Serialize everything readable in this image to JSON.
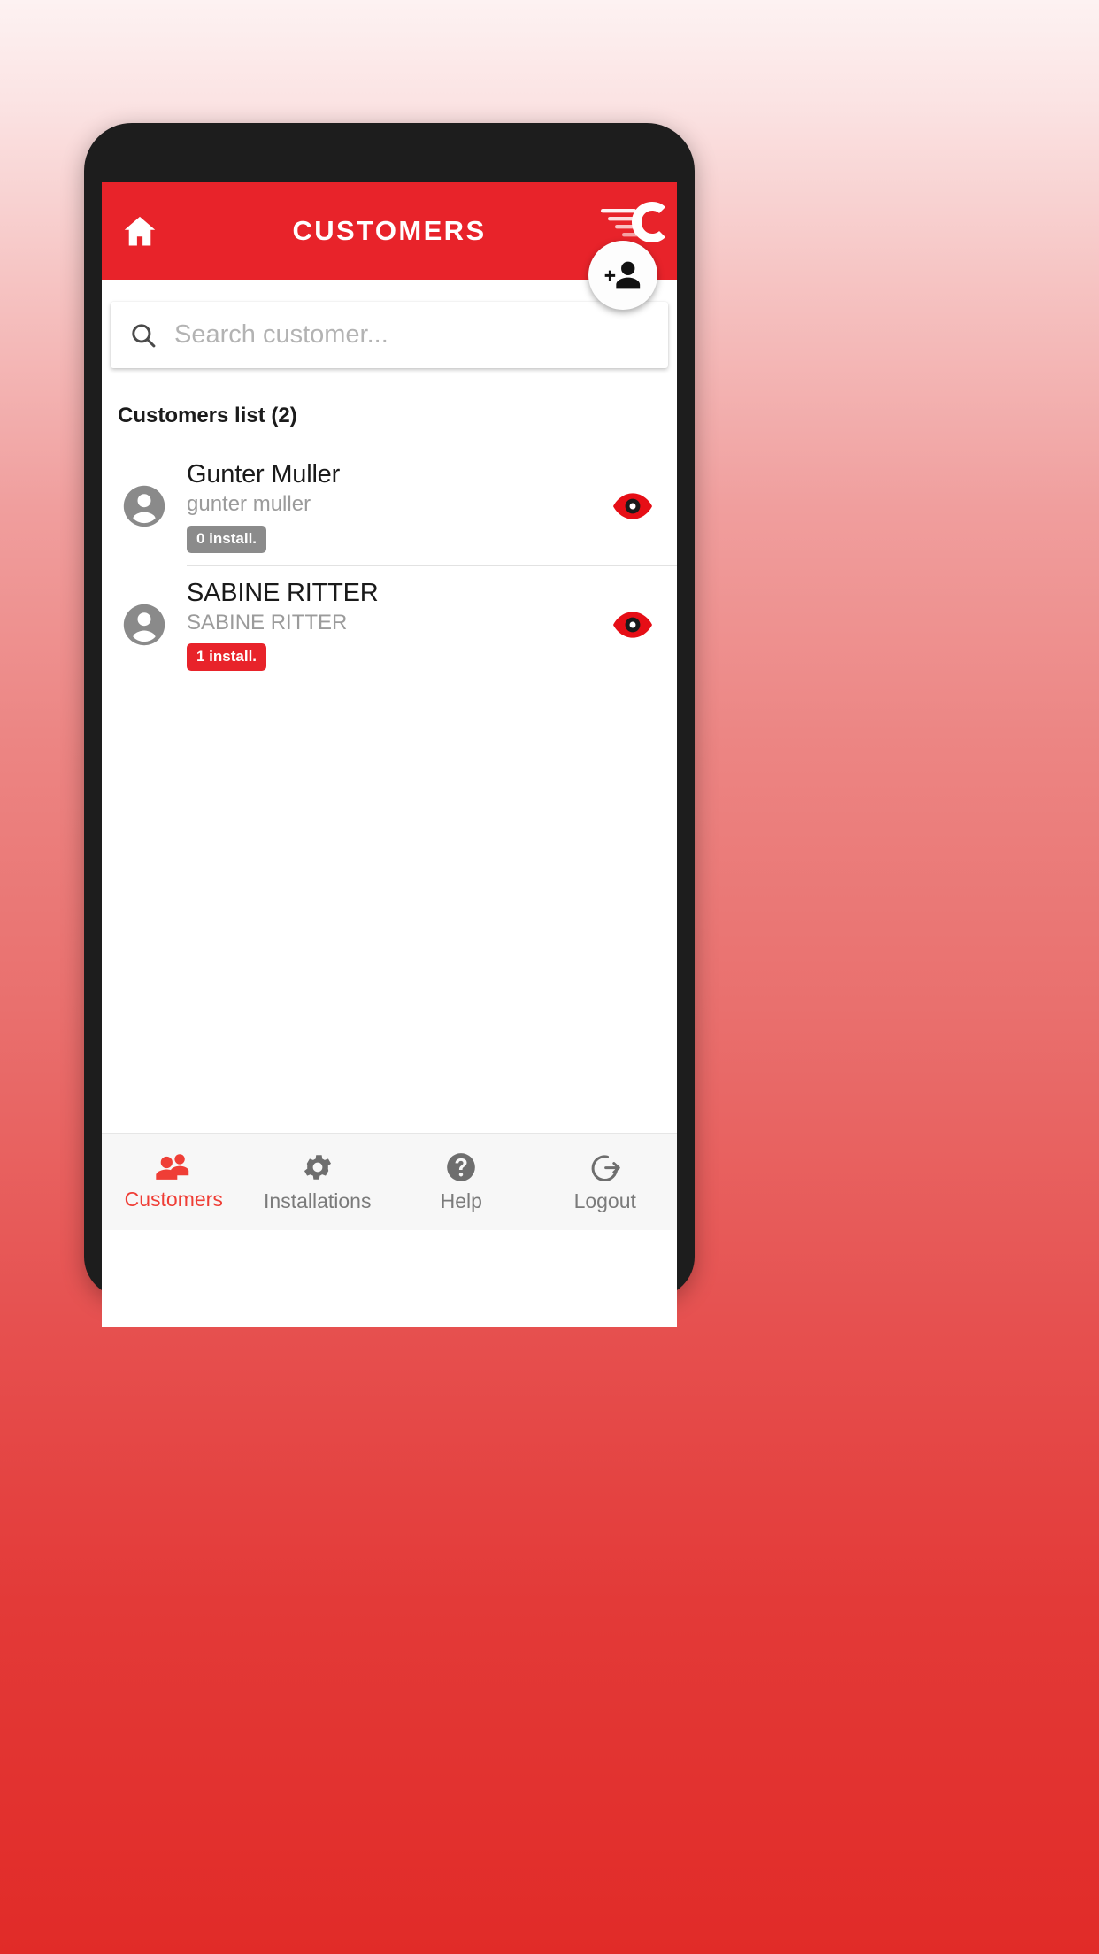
{
  "appbar": {
    "title": "CUSTOMERS",
    "home_icon": "home-icon",
    "brand_logo": "company-c-logo",
    "bg_color": "#e8232a"
  },
  "fab": {
    "icon": "add-person-icon",
    "label": "Add customer"
  },
  "search": {
    "icon": "search-icon",
    "placeholder": "Search customer...",
    "value": ""
  },
  "list": {
    "heading": "Customers list (2)",
    "count": 2,
    "rows": [
      {
        "avatar_icon": "person-avatar-icon",
        "name": "Gunter Muller",
        "subtitle": "gunter muller",
        "badge": "0 install.",
        "badge_color": "#8b8b8b",
        "action_icon": "eye-icon"
      },
      {
        "avatar_icon": "person-avatar-icon",
        "name": "SABINE RITTER",
        "subtitle": "SABINE RITTER",
        "badge": "1 install.",
        "badge_color": "#e8232a",
        "action_icon": "eye-icon"
      }
    ]
  },
  "bottom_nav": {
    "active_color": "#ef3e36",
    "inactive_color": "#7b7b7b",
    "items": [
      {
        "label": "Customers",
        "icon": "people-icon",
        "active": true
      },
      {
        "label": "Installations",
        "icon": "gear-icon",
        "active": false
      },
      {
        "label": "Help",
        "icon": "question-icon",
        "active": false
      },
      {
        "label": "Logout",
        "icon": "logout-icon",
        "active": false
      }
    ]
  }
}
